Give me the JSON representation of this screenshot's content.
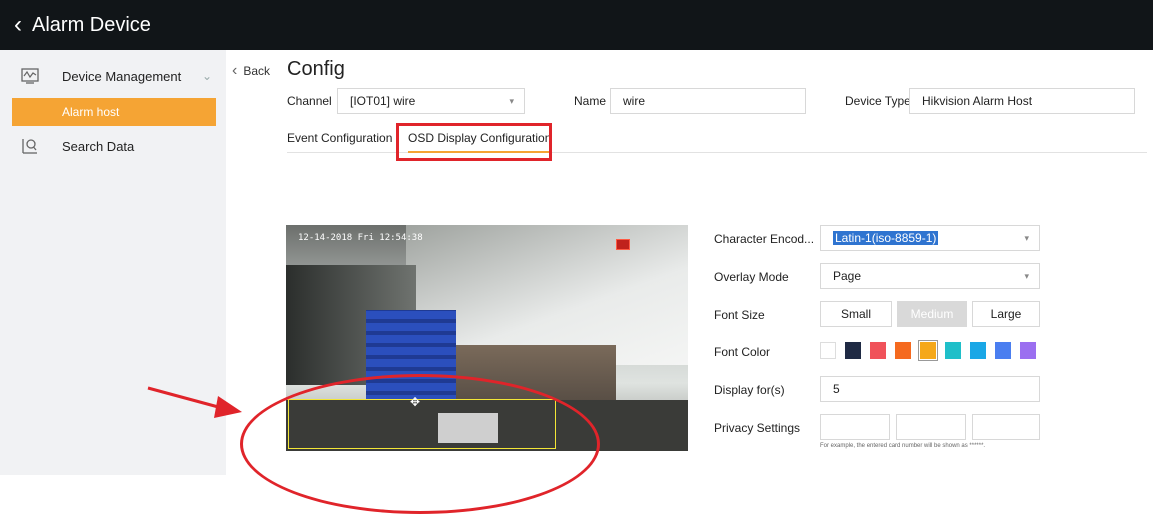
{
  "header": {
    "title": "Alarm Device"
  },
  "sidebar": {
    "items": [
      {
        "label": "Device Management",
        "icon": "device-management-icon"
      },
      {
        "label": "Alarm host"
      },
      {
        "label": "Search Data",
        "icon": "search-data-icon"
      }
    ]
  },
  "main": {
    "back_label": "Back",
    "title": "Config",
    "channel": {
      "label": "Channel",
      "value": "[IOT01] wire"
    },
    "name": {
      "label": "Name",
      "value": "wire"
    },
    "device_type": {
      "label": "Device Type",
      "value": "Hikvision Alarm Host"
    },
    "tabs": [
      {
        "label": "Event Configuration"
      },
      {
        "label": "OSD Display Configuration",
        "active": true
      }
    ]
  },
  "video": {
    "timestamp": "12-14-2018 Fri 12:54:38"
  },
  "osd": {
    "character_encoding": {
      "label": "Character Encod...",
      "value": "Latin-1(iso-8859-1)"
    },
    "overlay_mode": {
      "label": "Overlay Mode",
      "value": "Page"
    },
    "font_size": {
      "label": "Font Size",
      "options": [
        "Small",
        "Medium",
        "Large"
      ],
      "selected": "Medium"
    },
    "font_color": {
      "label": "Font Color",
      "colors": [
        "#ffffff",
        "#1f2a44",
        "#f0525a",
        "#f56a1f",
        "#f5a81a",
        "#1fbfc9",
        "#1aa7e6",
        "#4a7ef0",
        "#9b6ff0"
      ],
      "selected_index": 4
    },
    "display_for": {
      "label": "Display for(s)",
      "value": "5"
    },
    "privacy": {
      "label": "Privacy Settings",
      "hint": "For example, the entered card number will be shown as ******."
    }
  },
  "colors": {
    "accent": "#f5a434",
    "topbar": "#111518",
    "annotation_red": "#e0242a"
  }
}
